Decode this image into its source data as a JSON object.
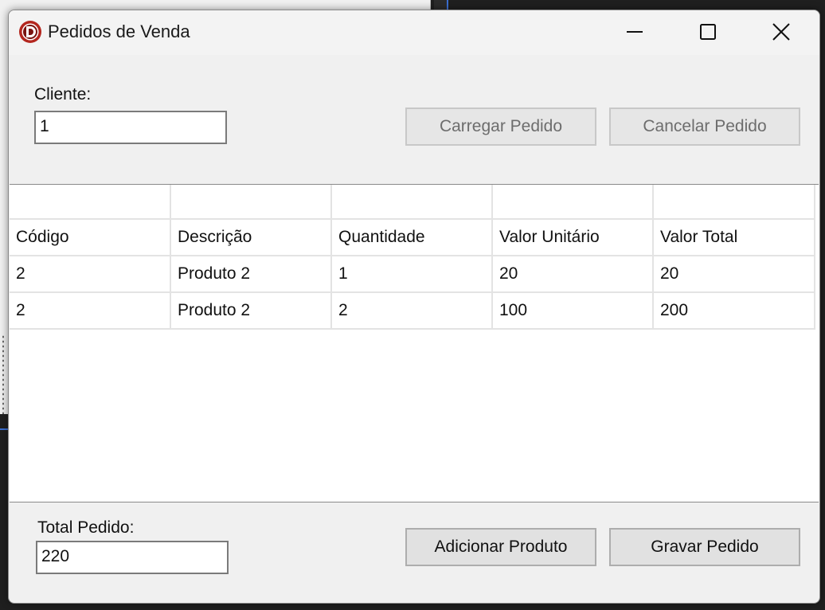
{
  "window": {
    "title": "Pedidos de Venda",
    "icon": "delphi-app-icon"
  },
  "titlebar_buttons": [
    "minimize-icon",
    "maximize-icon",
    "close-icon"
  ],
  "client": {
    "label": "Cliente:",
    "value": "1"
  },
  "top_buttons": {
    "load": "Carregar Pedido",
    "cancel": "Cancelar Pedido"
  },
  "grid": {
    "columns": [
      "Código",
      "Descrição",
      "Quantidade",
      "Valor Unitário",
      "Valor Total"
    ],
    "rows": [
      [
        "2",
        "Produto 2",
        "1",
        "20",
        "20"
      ],
      [
        "2",
        "Produto 2",
        "2",
        "100",
        "200"
      ]
    ]
  },
  "total": {
    "label": "Total Pedido:",
    "value": "220"
  },
  "bottom_buttons": {
    "add": "Adicionar Produto",
    "save": "Gravar Pedido"
  },
  "colors": {
    "window_bg": "#f0f0f0",
    "icon_red": "#b3261e"
  }
}
